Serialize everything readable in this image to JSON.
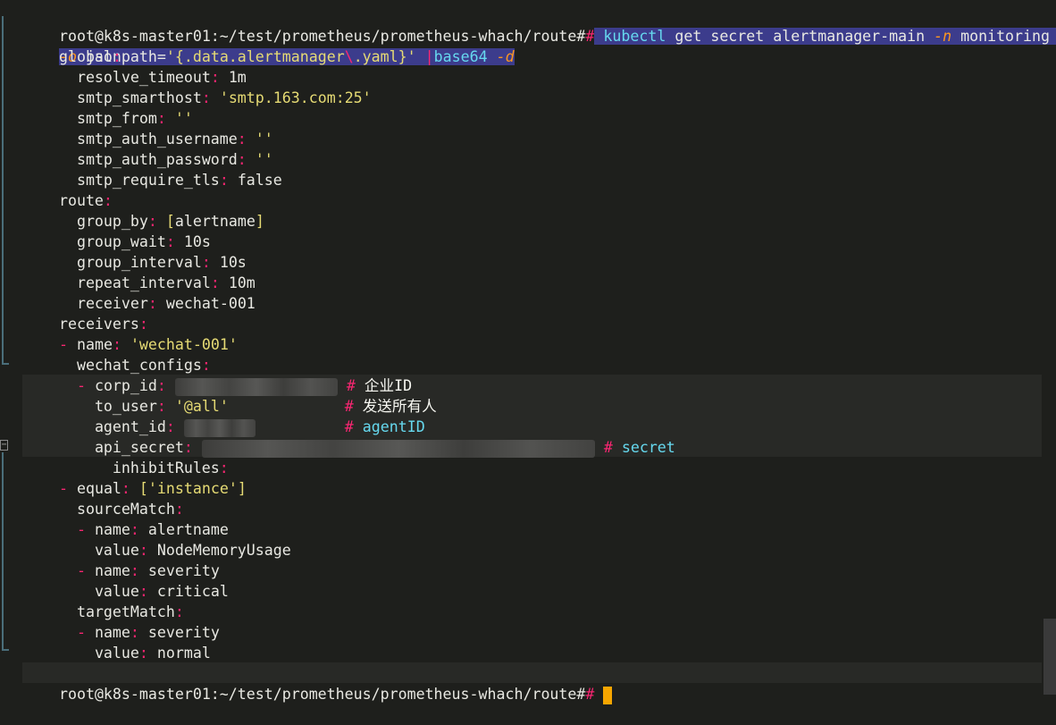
{
  "prompt": "root@k8s-master01:~/test/prometheus/prometheus-whach/route#",
  "command": {
    "kubectl": "kubectl",
    "get": "get",
    "secret": "secret",
    "name": "alertmanager-main",
    "flag_n": "-n",
    "namespace": "monitoring",
    "wrap_mark": "↩",
    "flag_o": "-o",
    "jsonpath_key": "jsonpath=",
    "jsonpath_val_a": "'{.data.alertmanager",
    "jsonpath_esc": "\\",
    "jsonpath_val_b": ".yaml}'",
    "pipe": "|",
    "base64": "base64",
    "flag_d": "-d"
  },
  "yaml": {
    "global": "global",
    "resolve_timeout_key": "resolve_timeout",
    "resolve_timeout_val": "1m",
    "smtp_smarthost_key": "smtp_smarthost",
    "smtp_smarthost_val": "'smtp.163.com:25'",
    "smtp_from_key": "smtp_from",
    "smtp_from_val": "''",
    "smtp_auth_username_key": "smtp_auth_username",
    "smtp_auth_username_val": "''",
    "smtp_auth_password_key": "smtp_auth_password",
    "smtp_auth_password_val": "''",
    "smtp_require_tls_key": "smtp_require_tls",
    "smtp_require_tls_val": "false",
    "route": "route",
    "group_by_key": "group_by",
    "group_by_val": "alertname",
    "group_wait_key": "group_wait",
    "group_wait_val": "10s",
    "group_interval_key": "group_interval",
    "group_interval_val": "10s",
    "repeat_interval_key": "repeat_interval",
    "repeat_interval_val": "10m",
    "receiver_key": "receiver",
    "receiver_val": "wechat-001",
    "receivers": "receivers",
    "name_key": "name",
    "receiver_name_val": "'wechat-001'",
    "wechat_configs": "wechat_configs",
    "corp_id_key": "corp_id",
    "corp_id_comment": "企业ID",
    "to_user_key": "to_user",
    "to_user_val": "'@all'",
    "to_user_comment": "发送所有人",
    "agent_id_key": "agent_id",
    "agent_id_comment": "agentID",
    "api_secret_key": "api_secret",
    "api_secret_comment": "secret",
    "inhibit_rules": "inhibitRules",
    "equal_key": "equal",
    "equal_val": "'instance'",
    "source_match": "sourceMatch",
    "sm_name1_val": "alertname",
    "value_key": "value",
    "sm_value1": "NodeMemoryUsage",
    "sm_name2_val": "severity",
    "sm_value2": "critical",
    "target_match": "targetMatch",
    "tm_name_val": "severity",
    "tm_value": "normal"
  },
  "colors": {
    "background": "#1e1f1c",
    "key": "#ffffff",
    "colon": "#f92672",
    "string": "#e6db74",
    "keyword": "#66d9ef",
    "flag": "#fd971f",
    "selection": "#3c3c8c",
    "cursor": "#f7a600"
  }
}
